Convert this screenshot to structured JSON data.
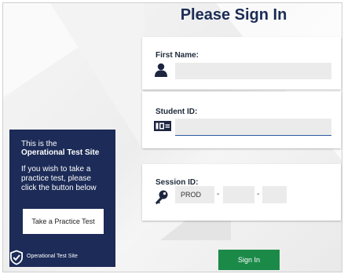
{
  "page": {
    "title": "Please Sign In"
  },
  "first_name": {
    "label": "First Name:",
    "value": "",
    "icon": "person-icon"
  },
  "student_id": {
    "label": "Student ID:",
    "value": "",
    "icon": "id-card-icon"
  },
  "session": {
    "label": "Session ID:",
    "icon": "key-icon",
    "prefix": "PROD",
    "separator": "-",
    "part2": "",
    "part3": ""
  },
  "signin": {
    "label": "Sign In",
    "color": "#1b8a48"
  },
  "practice_panel": {
    "line1": "This is the",
    "line2": "Operational Test Site",
    "line3": "If you wish to take a",
    "line4": "practice test, please",
    "line5": "click the button below",
    "button_label": "Take a Practice Test",
    "footer_text": "Operational Test Site",
    "footer_icon": "shield-check-icon",
    "background": "#1c2b57"
  },
  "colors": {
    "title": "#1b2c55",
    "input_bg": "#ebebeb",
    "focus_underline": "#2c5aa0"
  }
}
